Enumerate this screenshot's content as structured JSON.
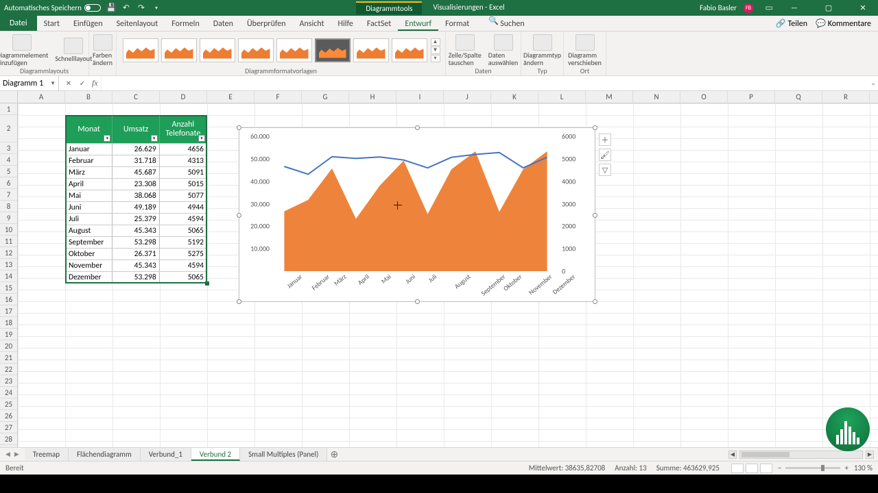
{
  "titlebar": {
    "autosave_label": "Automatisches Speichern",
    "context_tab": "Diagrammtools",
    "doc_title": "Visualisierungen - Excel",
    "user_name": "Fabio Basler",
    "user_initials": "FB"
  },
  "ribbon_tabs": {
    "file": "Datei",
    "items": [
      "Start",
      "Einfügen",
      "Seitenlayout",
      "Formeln",
      "Daten",
      "Überprüfen",
      "Ansicht",
      "Hilfe",
      "FactSet",
      "Entwurf",
      "Format"
    ],
    "active": "Entwurf",
    "search_label": "Suchen",
    "share": "Teilen",
    "comments": "Kommentare"
  },
  "ribbon": {
    "g_layouts": "Diagrammlayouts",
    "btn_add_element": "Diagrammelement hinzufügen",
    "btn_quick_layout": "Schnelllayout",
    "btn_colors": "Farben ändern",
    "g_styles": "Diagrammformatvorlagen",
    "g_data": "Daten",
    "btn_switch": "Zeile/Spalte tauschen",
    "btn_select_data": "Daten auswählen",
    "g_type": "Typ",
    "btn_change_type": "Diagrammtyp ändern",
    "g_location": "Ort",
    "btn_move": "Diagramm verschieben"
  },
  "namebox": "Diagramm 1",
  "columns": [
    "A",
    "B",
    "C",
    "D",
    "E",
    "F",
    "G",
    "H",
    "I",
    "J",
    "K",
    "L",
    "M",
    "N",
    "O",
    "P",
    "Q",
    "R"
  ],
  "rows": [
    1,
    2,
    3,
    4,
    5,
    6,
    7,
    8,
    9,
    10,
    11,
    12,
    13,
    14,
    15,
    16,
    17,
    18,
    19,
    20,
    21,
    22,
    23,
    24,
    25,
    26,
    27,
    28
  ],
  "table": {
    "headers": [
      "Monat",
      "Umsatz",
      "Anzahl Telefonate"
    ],
    "widths": [
      69,
      69,
      69
    ],
    "rows": [
      [
        "Januar",
        "26.629",
        "4656"
      ],
      [
        "Februar",
        "31.718",
        "4313"
      ],
      [
        "März",
        "45.687",
        "5091"
      ],
      [
        "April",
        "23.308",
        "5015"
      ],
      [
        "Mai",
        "38.068",
        "5077"
      ],
      [
        "Juni",
        "49.189",
        "4944"
      ],
      [
        "Juli",
        "25.379",
        "4594"
      ],
      [
        "August",
        "45.343",
        "5065"
      ],
      [
        "September",
        "53.298",
        "5192"
      ],
      [
        "Oktober",
        "26.371",
        "5275"
      ],
      [
        "November",
        "45.343",
        "4594"
      ],
      [
        "Dezember",
        "53.298",
        "5065"
      ]
    ]
  },
  "chart_data": {
    "type": "combo",
    "categories": [
      "Januar",
      "Februar",
      "März",
      "April",
      "Mai",
      "Juni",
      "Juli",
      "August",
      "September",
      "Oktober",
      "November",
      "Dezember"
    ],
    "series": [
      {
        "name": "Umsatz",
        "type": "area",
        "axis": "left",
        "color": "#ed7d31",
        "values": [
          26629,
          31718,
          45687,
          23308,
          38068,
          49189,
          25379,
          45343,
          53298,
          26371,
          45343,
          53298
        ]
      },
      {
        "name": "Anzahl Telefonate",
        "type": "line",
        "axis": "right",
        "color": "#4472c4",
        "values": [
          4656,
          4313,
          5091,
          5015,
          5077,
          4944,
          4594,
          5065,
          5192,
          5275,
          4594,
          5065
        ]
      }
    ],
    "y_left": {
      "min": 0,
      "max": 60000,
      "step": 10000,
      "ticks": [
        "60.000",
        "50.000",
        "40.000",
        "30.000",
        "20.000",
        "10.000"
      ]
    },
    "y_right": {
      "min": 0,
      "max": 6000,
      "step": 1000,
      "ticks": [
        "6000",
        "5000",
        "4000",
        "3000",
        "2000",
        "1000",
        "0"
      ]
    }
  },
  "sheets": {
    "tabs": [
      "Treemap",
      "Flächendiagramm",
      "Verbund_1",
      "Verbund 2",
      "Small Multiples (Panel)"
    ],
    "active": "Verbund 2"
  },
  "status": {
    "ready": "Bereit",
    "avg_label": "Mittelwert:",
    "avg": "38635,82708",
    "count_label": "Anzahl:",
    "count": "13",
    "sum_label": "Summe:",
    "sum": "463629,925",
    "zoom": "130 %"
  }
}
